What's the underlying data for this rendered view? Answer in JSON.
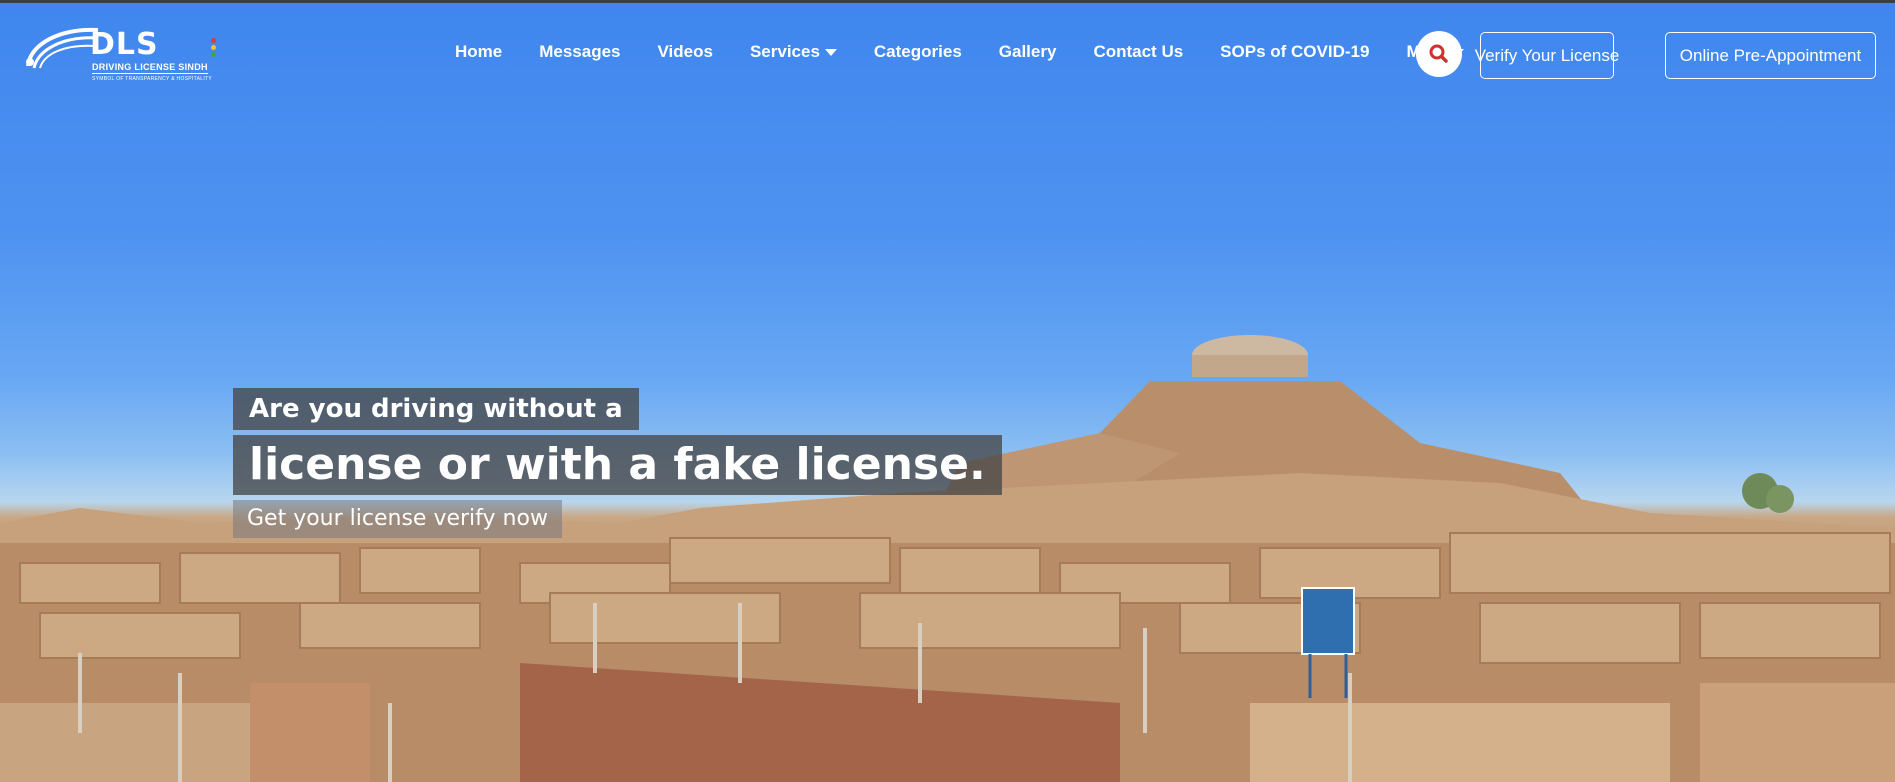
{
  "logo": {
    "wordmark": "DLS",
    "name": "DRIVING LICENSE SINDH",
    "tagline": "SYMBOL OF TRANSPARENCY & HOSPITALITY",
    "dot_colors": [
      "#e53935",
      "#fbc02d",
      "#43a047"
    ]
  },
  "nav": {
    "items": [
      {
        "label": "Home"
      },
      {
        "label": "Messages"
      },
      {
        "label": "Videos"
      },
      {
        "label": "Services",
        "has_dropdown": true
      },
      {
        "label": "Categories"
      },
      {
        "label": "Gallery"
      },
      {
        "label": "Contact Us"
      },
      {
        "label": "SOPs of COVID-19"
      },
      {
        "label": "More",
        "has_dropdown": true
      }
    ],
    "search_icon": "search-icon",
    "search_icon_color": "#d32f2f"
  },
  "buttons": {
    "verify": "Verify Your License",
    "appointment": "Online Pre-Appointment"
  },
  "hero": {
    "line1": "Are you driving without a",
    "line2": "license or with a fake license.",
    "line3": "Get your license verify now"
  }
}
